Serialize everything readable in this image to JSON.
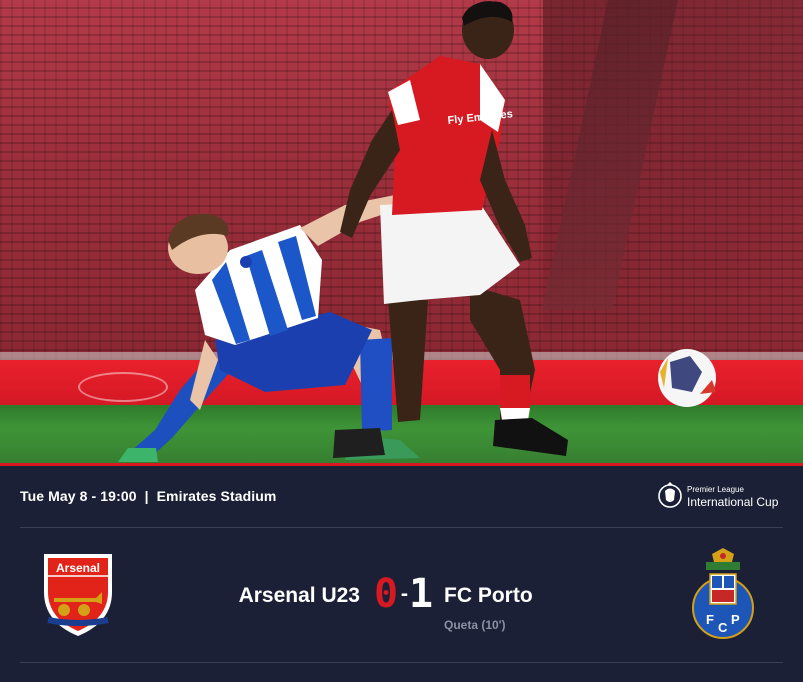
{
  "match": {
    "date_time": "Tue May 8 - 19:00",
    "separator": "|",
    "venue": "Emirates Stadium",
    "competition": {
      "line1": "Premier League",
      "line2": "International Cup"
    },
    "home": {
      "name": "Arsenal U23",
      "score": "0",
      "crest_text": "Arsenal",
      "crest_icon": "arsenal-crest-icon"
    },
    "away": {
      "name": "FC Porto",
      "score": "1",
      "crest_icon": "fc-porto-crest-icon",
      "scorers": "Queta (10')"
    },
    "score_separator": "-"
  },
  "photo": {
    "home_shirt_sponsor": "Fly Emirates"
  },
  "colors": {
    "background": "#1b2036",
    "accent_red": "#d71921",
    "muted_text": "#8c90a3"
  }
}
